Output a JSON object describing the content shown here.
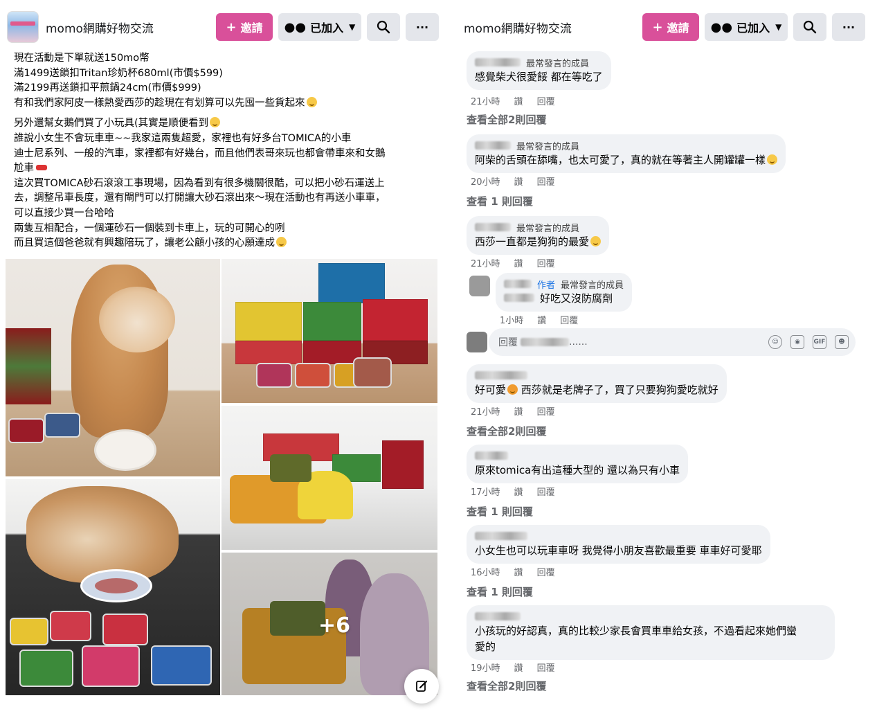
{
  "left": {
    "header": {
      "group_name": "momo網購好物交流",
      "invite_label": "邀請",
      "joined_label": "已加入"
    },
    "post": {
      "lines": [
        "現在活動是下單就送150mo幣",
        "滿1499送鎖扣Tritan珍奶杯680ml(市價$599)",
        "滿2199再送鎖扣平煎鍋24cm(市價$999)",
        "有和我們家阿皮一樣熱愛西莎的趁現在有划算可以先囤一些貨起來",
        "另外還幫女鵝們買了小玩具(其實是順便看到",
        "誰說小女生不會玩車車~~我家這兩隻超愛，家裡也有好多台TOMICA的小車",
        "迪士尼系列、一般的汽車，家裡都有好幾台，而且他們表哥來玩也都會帶車來和女鵝",
        "尬車",
        "這次買TOMICA砂石滾滾工事現場，因為看到有很多機關很酷，可以把小砂石運送上",
        "去，調整吊車長度，還有閘門可以打開讓大砂石滾出來～現在活動也有再送小車車，",
        "可以直接少買一台哈哈",
        "兩隻互相配合，一個運砂石一個裝到卡車上，玩的可開心的咧",
        "而且買這個爸爸就有興趣陪玩了，讓老公顧小孩的心願達成"
      ]
    },
    "photos": {
      "more_count": "+6"
    }
  },
  "right": {
    "header": {
      "group_name": "momo網購好物交流",
      "invite_label": "邀請",
      "joined_label": "已加入"
    },
    "comments": [
      {
        "badge": "最常發言的成員",
        "text": "感覺柴犬很愛餒 都在等吃了",
        "time": "21小時",
        "like": "讚",
        "reply": "回覆",
        "view_replies": "查看全部2則回覆"
      },
      {
        "badge": "最常發言的成員",
        "text": "阿柴的舌頭在舔嘴，也太可愛了，真的就在等著主人開罐罐一樣",
        "time": "20小時",
        "like": "讚",
        "reply": "回覆",
        "view_replies": "查看 1 則回覆"
      },
      {
        "badge": "最常發言的成員",
        "text": "西莎一直都是狗狗的最愛",
        "time": "21小時",
        "like": "讚",
        "reply": "回覆"
      },
      {
        "author_tag": "作者",
        "badge": "最常發言的成員",
        "text": "好吃又沒防腐劑",
        "time": "1小時",
        "like": "讚",
        "reply": "回覆"
      },
      {
        "reply_placeholder": "回覆",
        "reply_suffix": "......"
      },
      {
        "text_a": "好可愛",
        "text_b": " 西莎就是老牌子了，買了只要狗狗愛吃就好",
        "time": "21小時",
        "like": "讚",
        "reply": "回覆",
        "view_replies": "查看全部2則回覆"
      },
      {
        "text": "原來tomica有出這種大型的 還以為只有小車",
        "time": "17小時",
        "like": "讚",
        "reply": "回覆",
        "view_replies": "查看 1 則回覆"
      },
      {
        "text": "小女生也可以玩車車呀 我覺得小朋友喜歡最重要 車車好可愛耶",
        "time": "16小時",
        "like": "讚",
        "reply": "回覆",
        "view_replies": "查看 1 則回覆"
      },
      {
        "text": "小孩玩的好認真，真的比較少家長會買車車給女孩，不過看起來她們蠻",
        "text2": "愛的",
        "time": "19小時",
        "like": "讚",
        "reply": "回覆",
        "view_replies": "查看全部2則回覆"
      }
    ],
    "reply_tools": [
      "emoji-icon",
      "camera-icon",
      "gif-icon",
      "sticker-icon"
    ]
  }
}
